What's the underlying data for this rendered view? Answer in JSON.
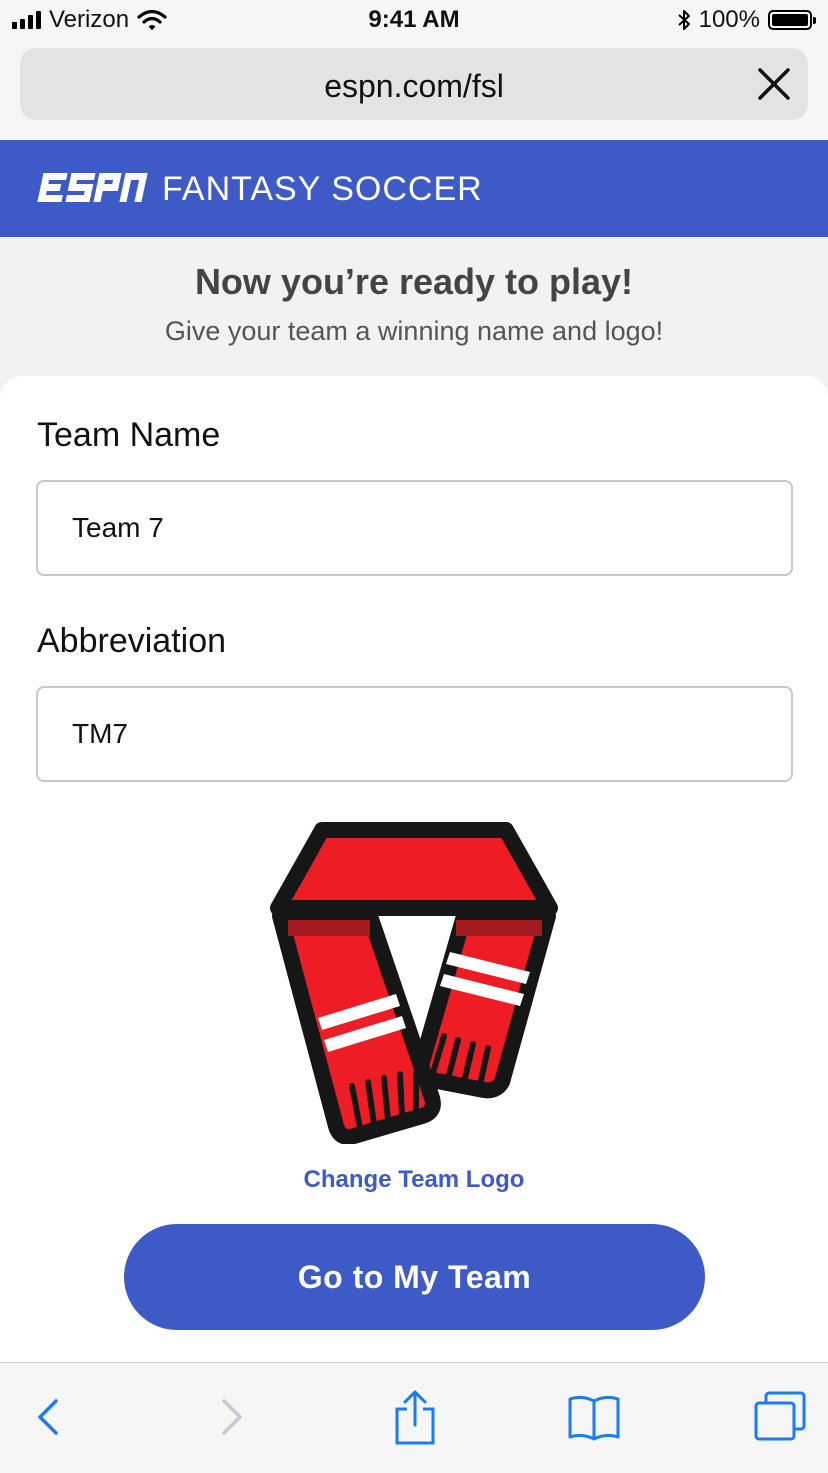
{
  "status_bar": {
    "carrier": "Verizon",
    "time": "9:41 AM",
    "battery_percent": "100%",
    "icons": [
      "signal-icon",
      "wifi-icon",
      "bluetooth-icon",
      "battery-icon"
    ]
  },
  "browser": {
    "url": "espn.com/fsl",
    "close_icon": "close-icon"
  },
  "header": {
    "logo_text": "ESPN",
    "title": "FANTASY SOCCER"
  },
  "intro": {
    "title": "Now you’re ready to play!",
    "subtitle": "Give your team a winning name and logo!"
  },
  "form": {
    "team_name_label": "Team Name",
    "team_name_value": "Team 7",
    "abbreviation_label": "Abbreviation",
    "abbreviation_value": "TM7"
  },
  "logo": {
    "icon": "scarf-icon",
    "change_link": "Change Team Logo"
  },
  "primary_button": "Go to My Team",
  "toolbar": {
    "items": [
      "back-icon",
      "forward-icon",
      "share-icon",
      "bookmarks-icon",
      "tabs-icon"
    ]
  },
  "colors": {
    "brand_blue": "#3e5ac6",
    "scarf_red": "#ee1c25",
    "ios_blue": "#1a7cf5"
  }
}
